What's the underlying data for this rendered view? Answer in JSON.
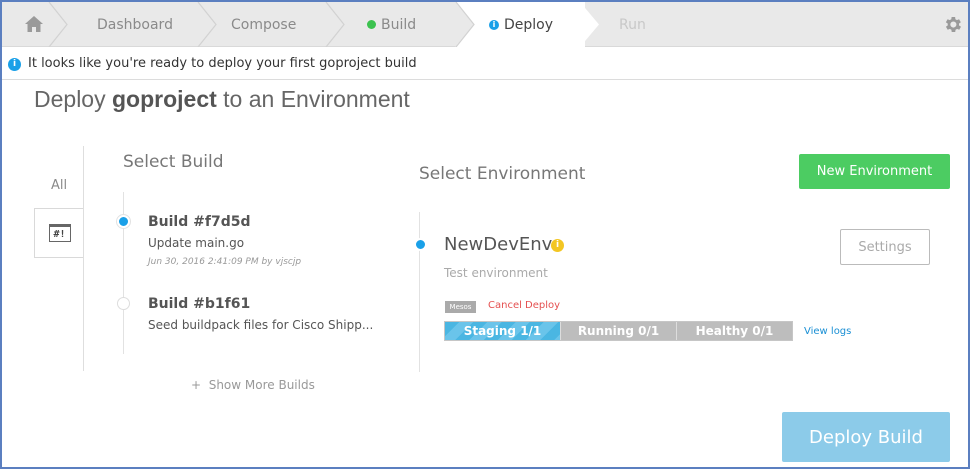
{
  "nav": {
    "steps": [
      {
        "label": "Dashboard"
      },
      {
        "label": "Compose"
      },
      {
        "label": "Build"
      },
      {
        "label": "Deploy"
      },
      {
        "label": "Run"
      }
    ],
    "home_icon": "home-icon",
    "settings_icon": "gear-icon",
    "build_status_color": "#3cc24f",
    "deploy_status_color": "#1aa0e8"
  },
  "banner": {
    "text": "It looks like you're ready to deploy your first goproject build",
    "icon": "info-icon"
  },
  "heading": {
    "prefix": "Deploy ",
    "project": "goproject",
    "suffix": " to an Environment"
  },
  "left_tabs": {
    "all": "All",
    "terminal_label": "#!"
  },
  "select_build": {
    "title": "Select Build",
    "builds": [
      {
        "name": "Build #f7d5d",
        "message": "Update main.go",
        "meta": "Jun 30, 2016 2:41:09 PM by vjscjp",
        "selected": true
      },
      {
        "name": "Build #b1f61",
        "message": "Seed buildpack files for Cisco Shipp...",
        "meta": "",
        "selected": false
      }
    ],
    "show_more": "Show More Builds"
  },
  "select_environment": {
    "title": "Select Environment",
    "new_button": "New Environment",
    "env": {
      "name": "NewDevEnv",
      "description": "Test environment",
      "settings_label": "Settings",
      "badge": "Mesos",
      "cancel_label": "Cancel Deploy",
      "progress": [
        {
          "label": "Staging 1/1",
          "fraction": 0.33,
          "state": "active"
        },
        {
          "label": "Running 0/1",
          "fraction": 0.33,
          "state": "pending"
        },
        {
          "label": "Healthy 0/1",
          "fraction": 0.34,
          "state": "pending"
        }
      ],
      "view_logs": "View logs"
    }
  },
  "deploy_button": "Deploy Build",
  "colors": {
    "accent": "#1aa0e8",
    "success": "#4ccc62",
    "danger": "#e55050",
    "deploy_disabled": "#8ccbe9"
  }
}
